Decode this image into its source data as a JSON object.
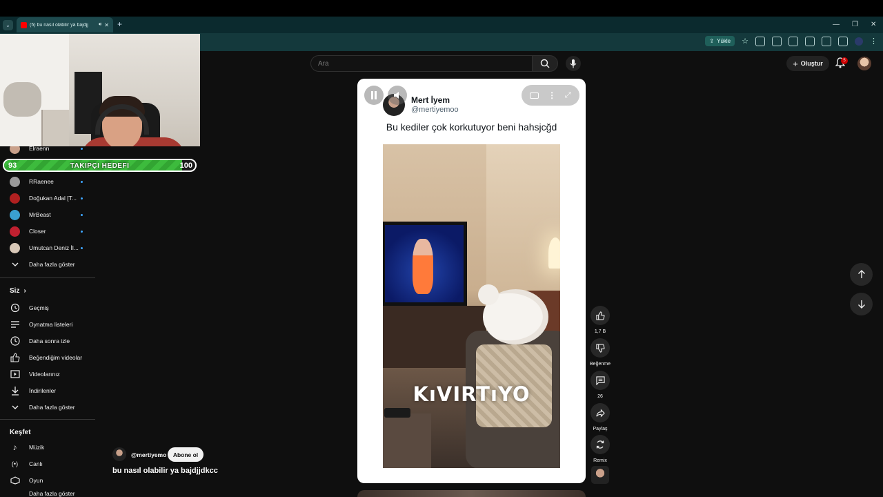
{
  "browser": {
    "tab_title": "(5) bu nasıl olabilir ya bajdjj",
    "upload_label": "Yükle"
  },
  "header": {
    "search_placeholder": "Ara",
    "create_label": "Oluştur",
    "notification_count": "5"
  },
  "goal_bar": {
    "start": "93",
    "label": "TAKIPÇI HEDEFI",
    "end": "100",
    "progress_fraction": 0.93
  },
  "sidebar": {
    "subscriptions": [
      {
        "label": "Elraenn",
        "color": "#c9a08a"
      },
      {
        "label": "RRaenee",
        "color": "#9a9a9a"
      },
      {
        "label": "Doğukan Adal [T...",
        "color": "#b02020"
      },
      {
        "label": "MrBeast",
        "color": "#3aa0d0"
      },
      {
        "label": "Closer",
        "color": "#c02030"
      },
      {
        "label": "Umutcan Deniz İl...",
        "color": "#d8c8b8"
      }
    ],
    "show_more_1": "Daha fazla göster",
    "you_heading": "Siz",
    "you_items": [
      {
        "label": "Geçmiş",
        "icon": "history-icon"
      },
      {
        "label": "Oynatma listeleri",
        "icon": "playlist-icon"
      },
      {
        "label": "Daha sonra izle",
        "icon": "clock-icon"
      },
      {
        "label": "Beğendiğim videolar",
        "icon": "thumb-up-icon"
      },
      {
        "label": "Videolarınız",
        "icon": "video-icon"
      },
      {
        "label": "İndirilenler",
        "icon": "download-icon"
      }
    ],
    "show_more_2": "Daha fazla göster",
    "explore_heading": "Keşfet",
    "explore_items": [
      {
        "label": "Müzik",
        "icon": "music-icon"
      },
      {
        "label": "Canlı",
        "icon": "live-icon"
      },
      {
        "label": "Oyun",
        "icon": "gaming-icon"
      }
    ],
    "show_more_3": "Daha fazla göster"
  },
  "short": {
    "tweet_name": "Mert İyem",
    "tweet_handle": "@mertiyemoo",
    "tweet_text": "Bu kediler çok korkutuyor beni hahsjcğd",
    "video_caption": "KıVIRTıYO",
    "channel_handle": "@mertiyemo",
    "subscribe_label": "Abone ol",
    "title": "bu nasıl olabilir ya bajdjjdkcc"
  },
  "actions": {
    "like_count": "1,7 B",
    "dislike_label": "Beğenme",
    "comment_count": "26",
    "share_label": "Paylaş",
    "remix_label": "Remix"
  },
  "colors": {
    "background": "#0f0f0f",
    "tabstrip": "#0b2a2e",
    "goal_green": "#3dbb3d",
    "badge_red": "#cc0000"
  }
}
